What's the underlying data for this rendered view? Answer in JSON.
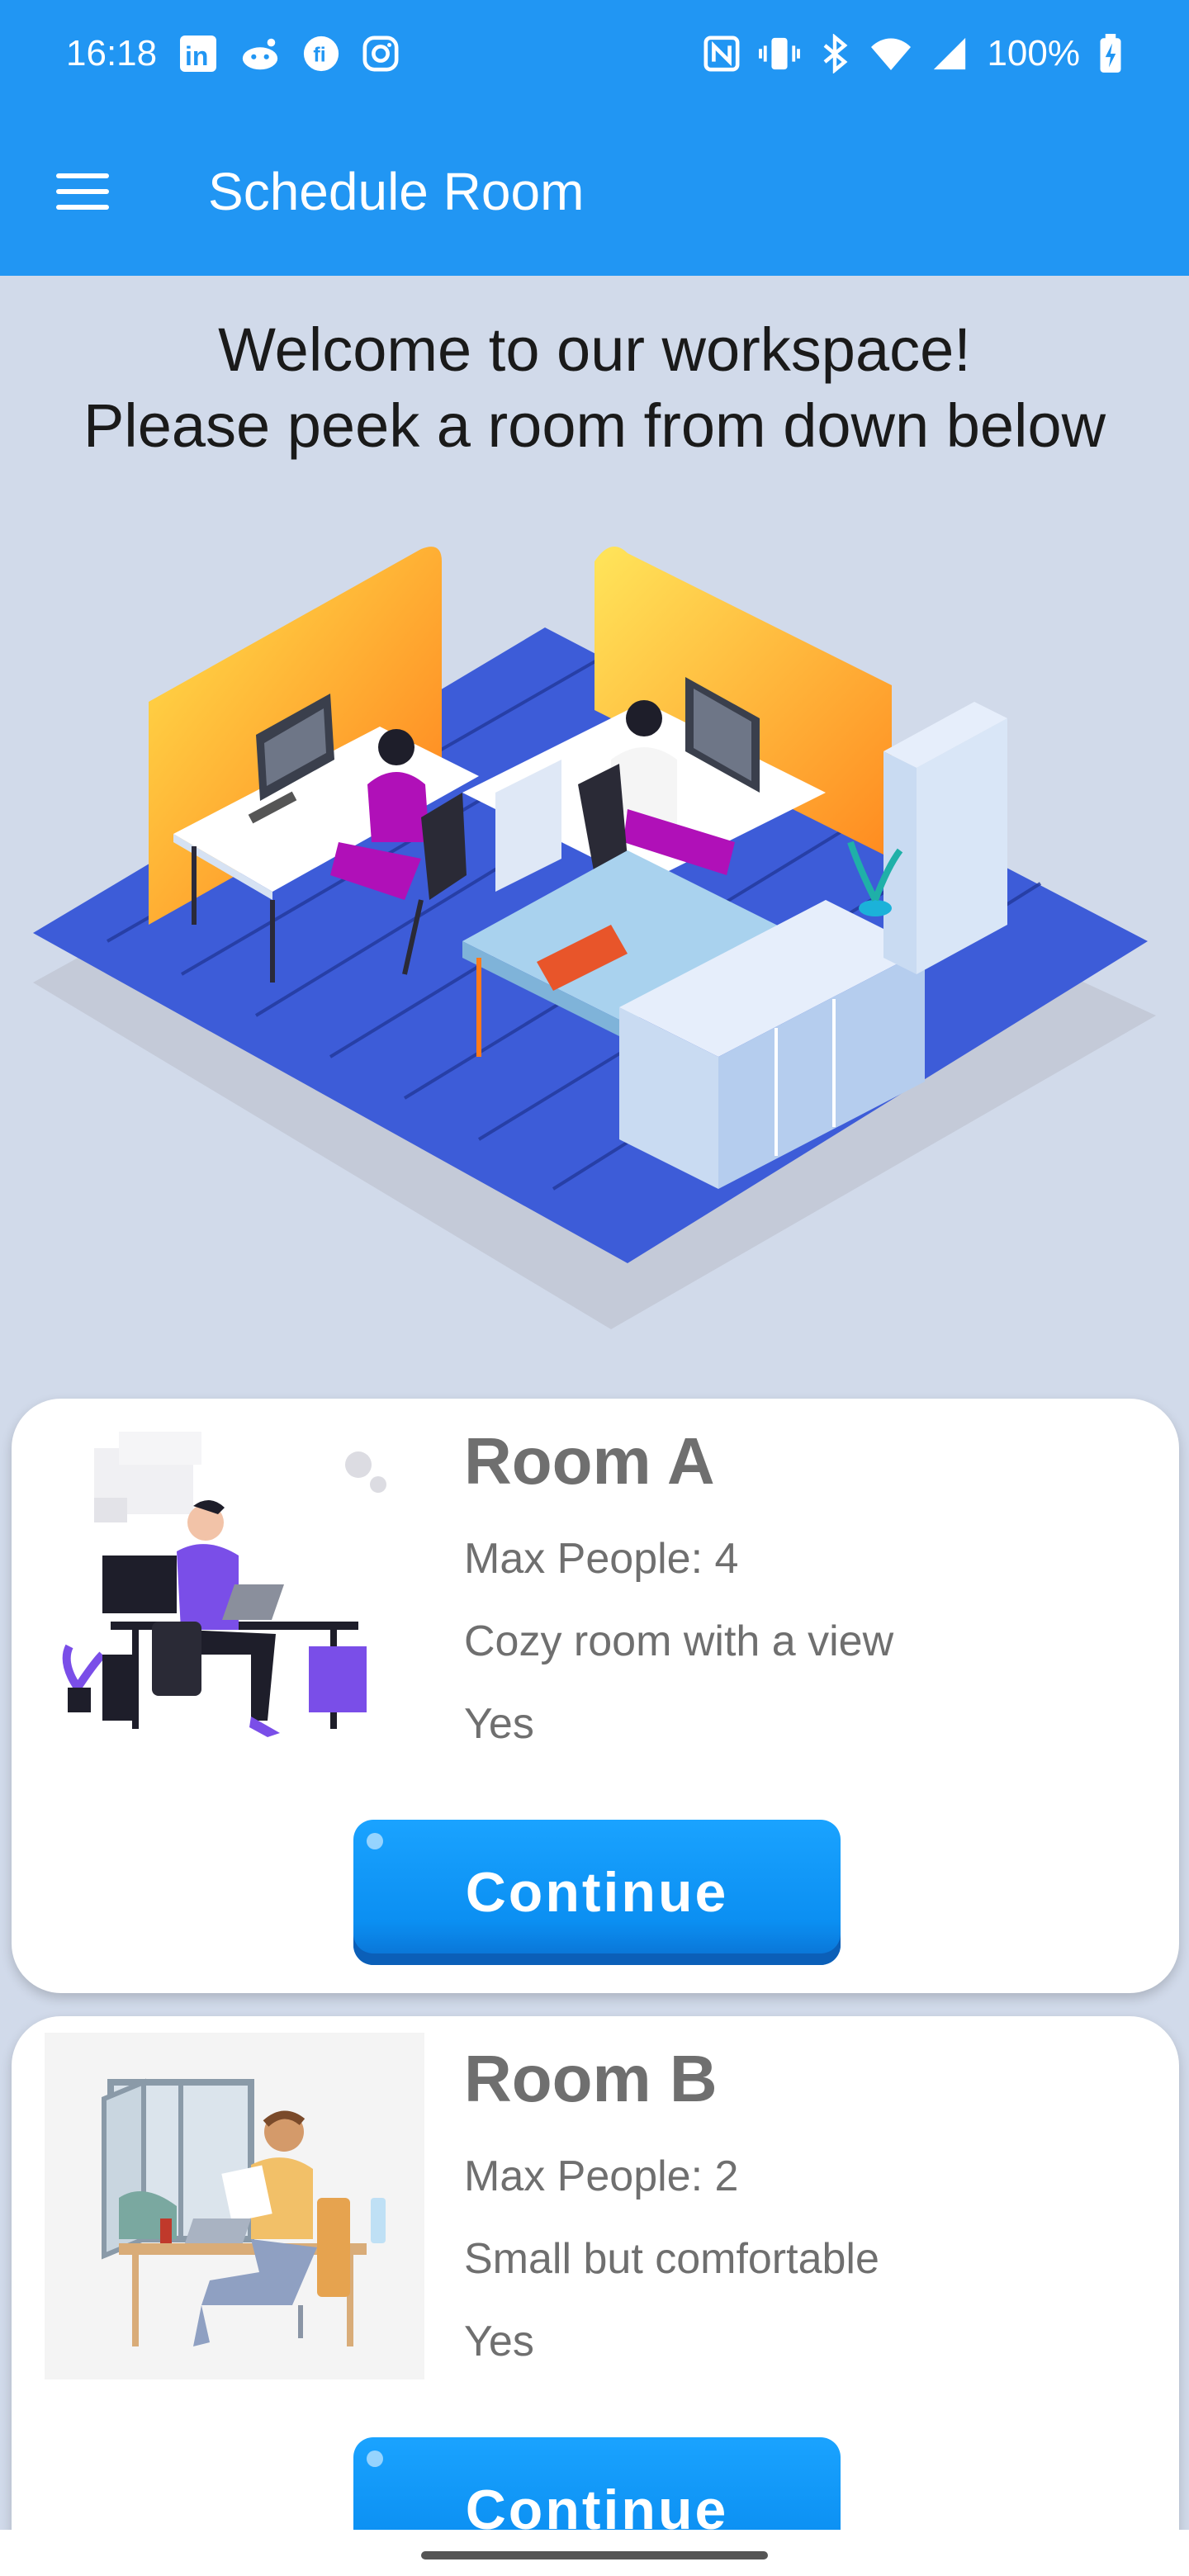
{
  "status_bar": {
    "time": "16:18",
    "battery": "100%",
    "left_icons": [
      "linkedin-icon",
      "reddit-icon",
      "fitbit-icon",
      "instagram-icon"
    ],
    "right_icons": [
      "nfc-icon",
      "vibrate-icon",
      "bluetooth-icon",
      "wifi-icon",
      "signal-icon",
      "battery-charging-icon"
    ]
  },
  "app_bar": {
    "title": "Schedule Room",
    "menu_icon": "hamburger-menu-icon"
  },
  "welcome": {
    "line1": "Welcome to our workspace!",
    "line2": "Please peek a room from down below"
  },
  "rooms": [
    {
      "name": "Room A",
      "max_people": "Max People: 4",
      "description": "Cozy room with a view",
      "available": "Yes",
      "button": "Continue"
    },
    {
      "name": "Room B",
      "max_people": "Max People: 2",
      "description": "Small but comfortable",
      "available": "Yes",
      "button": "Continue"
    }
  ],
  "colors": {
    "primary": "#2196f3",
    "background": "#d1daea",
    "button": "#0b8ff2",
    "text_muted": "#6f6f6f"
  }
}
